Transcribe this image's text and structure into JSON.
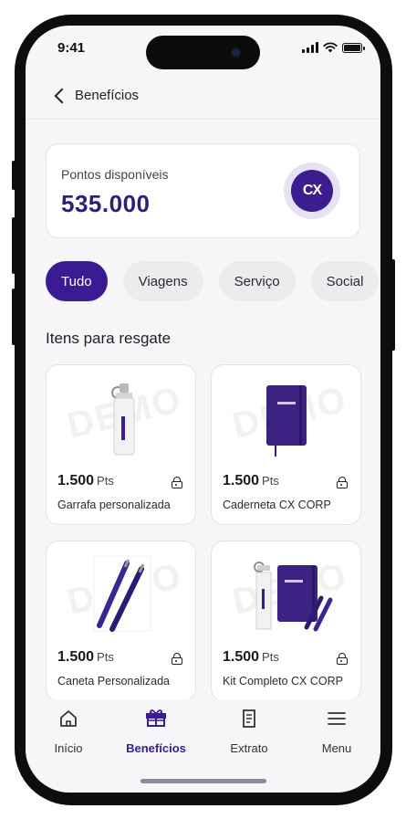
{
  "status_bar": {
    "time": "9:41"
  },
  "header": {
    "back_label": "Benefícios"
  },
  "points": {
    "label": "Pontos disponíveis",
    "value": "535.000",
    "logo_text": "CX"
  },
  "filters": [
    {
      "label": "Tudo",
      "active": true
    },
    {
      "label": "Viagens",
      "active": false
    },
    {
      "label": "Serviço",
      "active": false
    },
    {
      "label": "Social",
      "active": false
    }
  ],
  "section_title": "Itens para resgate",
  "watermark": "DEMO",
  "products": [
    {
      "price": "1.500",
      "unit": "Pts",
      "name": "Garrafa personalizada",
      "image": "water-bottle"
    },
    {
      "price": "1.500",
      "unit": "Pts",
      "name": "Caderneta CX CORP",
      "image": "notebook"
    },
    {
      "price": "1.500",
      "unit": "Pts",
      "name": "Caneta Personalizada",
      "image": "pens"
    },
    {
      "price": "1.500",
      "unit": "Pts",
      "name": "Kit Completo CX CORP",
      "image": "kit"
    }
  ],
  "nav": [
    {
      "label": "Início",
      "icon": "home-icon",
      "active": false
    },
    {
      "label": "Benefícios",
      "icon": "gift-icon",
      "active": true
    },
    {
      "label": "Extrato",
      "icon": "receipt-icon",
      "active": false
    },
    {
      "label": "Menu",
      "icon": "menu-icon",
      "active": false
    }
  ],
  "colors": {
    "primary": "#3a1b91",
    "points_text": "#2f1d7a",
    "background": "#f6f5f8"
  }
}
